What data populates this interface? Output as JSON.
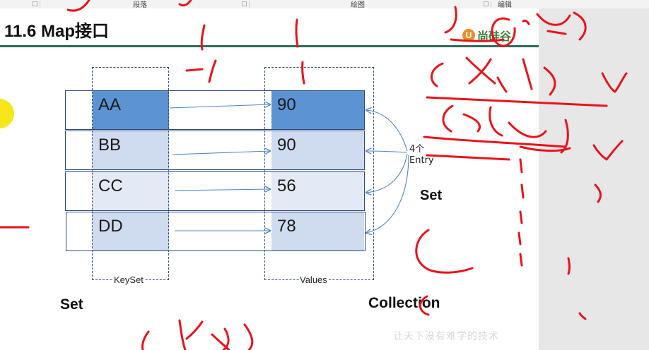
{
  "ribbon": {
    "groups": [
      "段落",
      "绘图",
      "编辑"
    ]
  },
  "slide": {
    "title": "11.6 Map接口",
    "logo_text": "尚硅谷",
    "logo_mark": "U",
    "rows": [
      {
        "key": "AA",
        "value": "90"
      },
      {
        "key": "BB",
        "value": "90"
      },
      {
        "key": "CC",
        "value": "56"
      },
      {
        "key": "DD",
        "value": "78"
      }
    ],
    "keyset_label": "KeySet",
    "values_label": "Values",
    "entry_label_line1": "4个",
    "entry_label_line2": "Entry",
    "set_label_left": "Set",
    "set_label_right": "Set",
    "collection_label": "Collection",
    "watermark": "让天下没有难学的技术"
  },
  "colors": {
    "highlight_blue": "#5b93d3",
    "light_blue": "#cfdbee",
    "lighter_blue": "#e3e9f5",
    "ink_red": "#e8131b",
    "arrow_blue": "#4f86c6",
    "title_rule": "#2f6b5a"
  }
}
